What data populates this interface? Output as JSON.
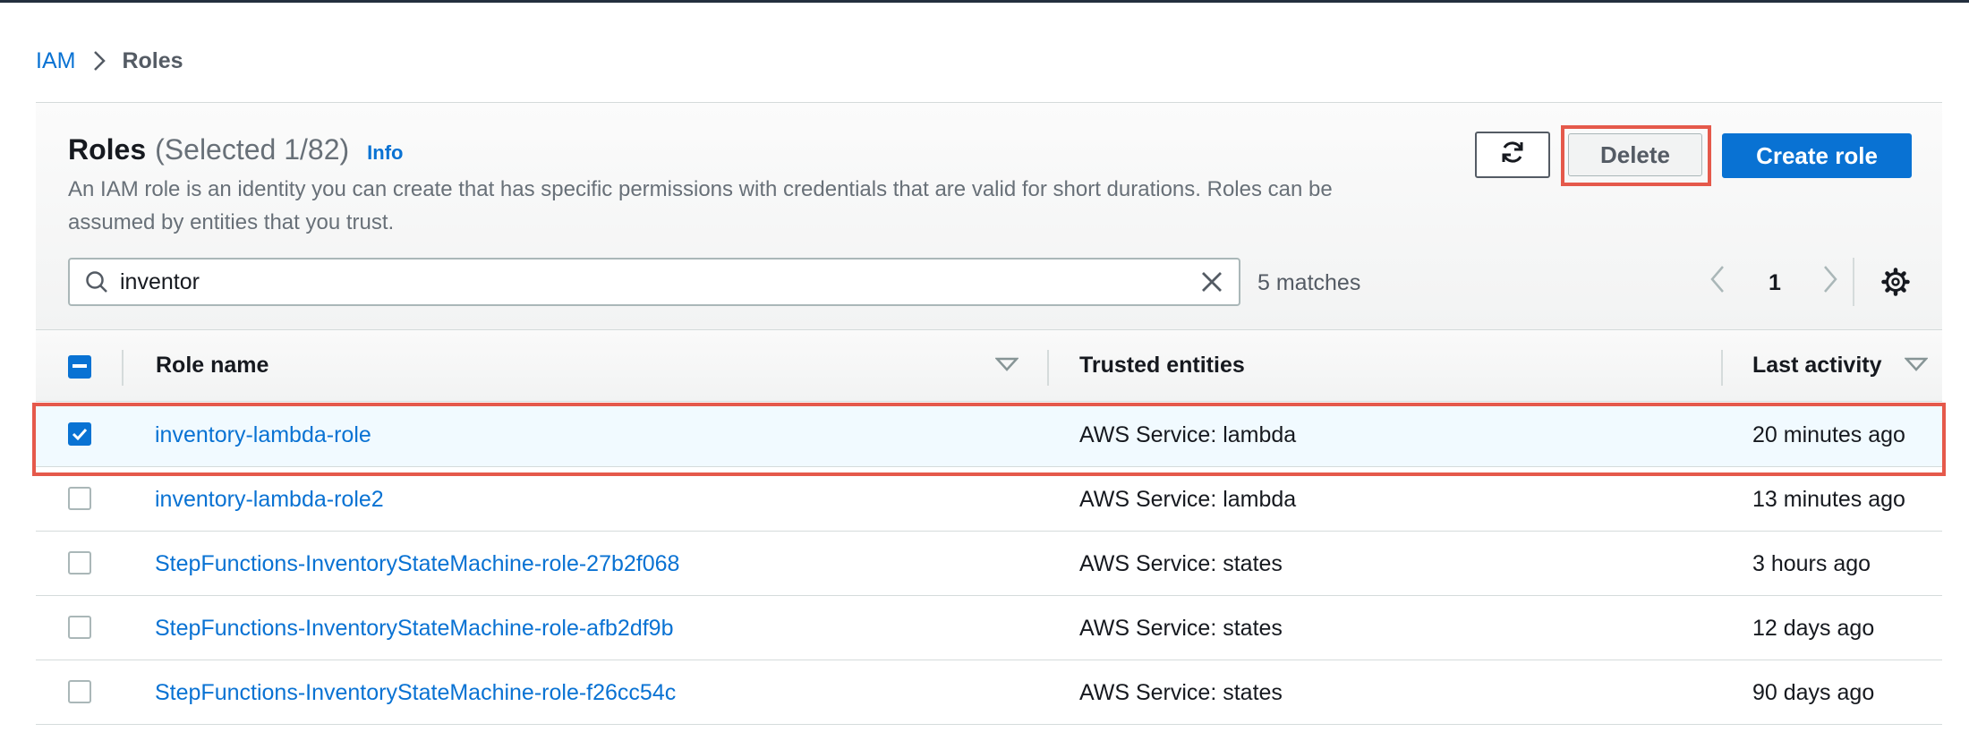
{
  "breadcrumb": {
    "root": "IAM",
    "current": "Roles"
  },
  "panel": {
    "title": "Roles",
    "selected_count": "(Selected 1/82)",
    "info_link": "Info",
    "description": "An IAM role is an identity you can create that has specific permissions with credentials that are valid for short durations. Roles can be assumed by entities that you trust."
  },
  "actions": {
    "refresh_icon": "refresh-icon",
    "delete_label": "Delete",
    "create_label": "Create role"
  },
  "search": {
    "value": "inventor",
    "matches": "5 matches"
  },
  "pagination": {
    "current_page": "1"
  },
  "table": {
    "columns": [
      "Role name",
      "Trusted entities",
      "Last activity"
    ],
    "rows": [
      {
        "name": "inventory-lambda-role",
        "trusted": "AWS Service: lambda",
        "activity": "20 minutes ago",
        "selected": true
      },
      {
        "name": "inventory-lambda-role2",
        "trusted": "AWS Service: lambda",
        "activity": "13 minutes ago",
        "selected": false
      },
      {
        "name": "StepFunctions-InventoryStateMachine-role-27b2f068",
        "trusted": "AWS Service: states",
        "activity": "3 hours ago",
        "selected": false
      },
      {
        "name": "StepFunctions-InventoryStateMachine-role-afb2df9b",
        "trusted": "AWS Service: states",
        "activity": "12 days ago",
        "selected": false
      },
      {
        "name": "StepFunctions-InventoryStateMachine-role-f26cc54c",
        "trusted": "AWS Service: states",
        "activity": "90 days ago",
        "selected": false
      }
    ]
  },
  "colors": {
    "link": "#0972d3",
    "primary": "#0972d3",
    "highlight": "#e5594b",
    "selected_row": "#f1faff"
  }
}
